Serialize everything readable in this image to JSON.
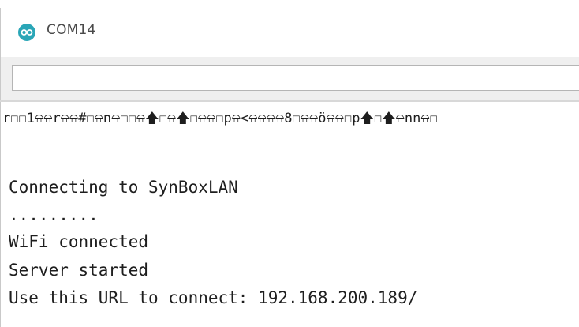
{
  "window": {
    "title": "COM14",
    "icon": "arduino-infinity-icon",
    "accent": "#2aa6b7"
  },
  "send": {
    "value": "",
    "placeholder": ""
  },
  "output": {
    "lines": [
      "r☐☐1⍾⍾r⍾⍾#☐⍾n⍾☐☐⍾🡅☐⍾🡅☐⍾⍾☐p⍾<⍾⍾⍾⍾8☐⍾⍾ö⍾⍾☐p🡅☐🡅⍾nn⍾☐",
      "",
      "Connecting to SynBoxLAN",
      ".........",
      "WiFi connected",
      "Server started",
      "Use this URL to connect: 192.168.200.189/"
    ]
  }
}
